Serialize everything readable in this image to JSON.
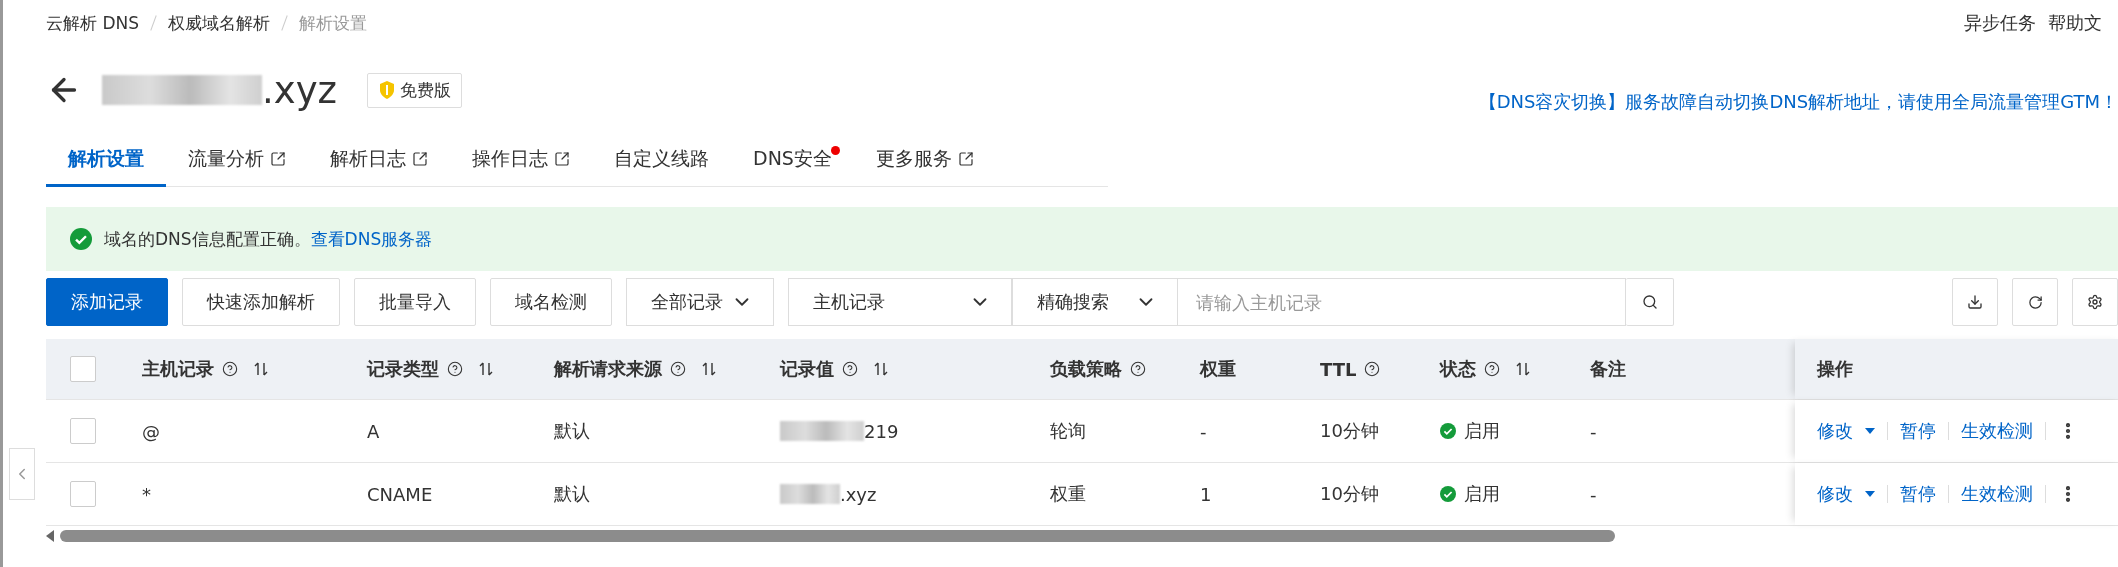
{
  "breadcrumb": [
    "云解析 DNS",
    "权威域名解析",
    "解析设置"
  ],
  "top_links": [
    "异步任务",
    "帮助文"
  ],
  "title": {
    "text": ".xyz",
    "redacted": true,
    "badge": "免费版"
  },
  "notice": "【DNS容灾切换】服务故障自动切换DNS解析地址，请使用全局流量管理GTM！",
  "tabs": [
    {
      "label": "解析设置",
      "selected": true,
      "external": false,
      "dot": false
    },
    {
      "label": "流量分析",
      "selected": false,
      "external": true,
      "dot": false
    },
    {
      "label": "解析日志",
      "selected": false,
      "external": true,
      "dot": false
    },
    {
      "label": "操作日志",
      "selected": false,
      "external": true,
      "dot": false
    },
    {
      "label": "自定义线路",
      "selected": false,
      "external": false,
      "dot": false
    },
    {
      "label": "DNS安全",
      "selected": false,
      "external": false,
      "dot": true
    },
    {
      "label": "更多服务",
      "selected": false,
      "external": true,
      "dot": false
    }
  ],
  "alert": {
    "text": "域名的DNS信息配置正确。",
    "link": "查看DNS服务器"
  },
  "toolbar": {
    "buttons": [
      {
        "label": "添加记录",
        "primary": true
      },
      {
        "label": "快速添加解析",
        "primary": false
      },
      {
        "label": "批量导入",
        "primary": false
      },
      {
        "label": "域名检测",
        "primary": false
      }
    ],
    "selects": [
      "全部记录",
      "主机记录",
      "精确搜索"
    ],
    "search": {
      "placeholder": "请输入主机记录"
    }
  },
  "table": {
    "columns": [
      {
        "label": "主机记录",
        "help": true,
        "sortable": true
      },
      {
        "label": "记录类型",
        "help": true,
        "sortable": true
      },
      {
        "label": "解析请求来源",
        "help": true,
        "sortable": true
      },
      {
        "label": "记录值",
        "help": true,
        "sortable": true
      },
      {
        "label": "负载策略",
        "help": true,
        "sortable": false
      },
      {
        "label": "权重",
        "help": false,
        "sortable": false
      },
      {
        "label": "TTL",
        "help": true,
        "sortable": false
      },
      {
        "label": "状态",
        "help": true,
        "sortable": true
      },
      {
        "label": "备注",
        "help": false,
        "sortable": false
      }
    ],
    "select_all_checked": false,
    "action_column": "操作",
    "rows": [
      {
        "checked": false,
        "host": "@",
        "type": "A",
        "source": "默认",
        "value": "219",
        "value_redacted": true,
        "strategy": "轮询",
        "weight": "-",
        "ttl": "10分钟",
        "status": {
          "text": "启用",
          "on": true
        },
        "note": "-",
        "actions": [
          "修改",
          "暂停",
          "生效检测"
        ]
      },
      {
        "checked": false,
        "host": "*",
        "type": "CNAME",
        "source": "默认",
        "value": ".xyz",
        "value_redacted": true,
        "strategy": "权重",
        "weight": "1",
        "ttl": "10分钟",
        "status": {
          "text": "启用",
          "on": true
        },
        "note": "-",
        "actions": [
          "修改",
          "暂停",
          "生效检测"
        ]
      }
    ]
  }
}
